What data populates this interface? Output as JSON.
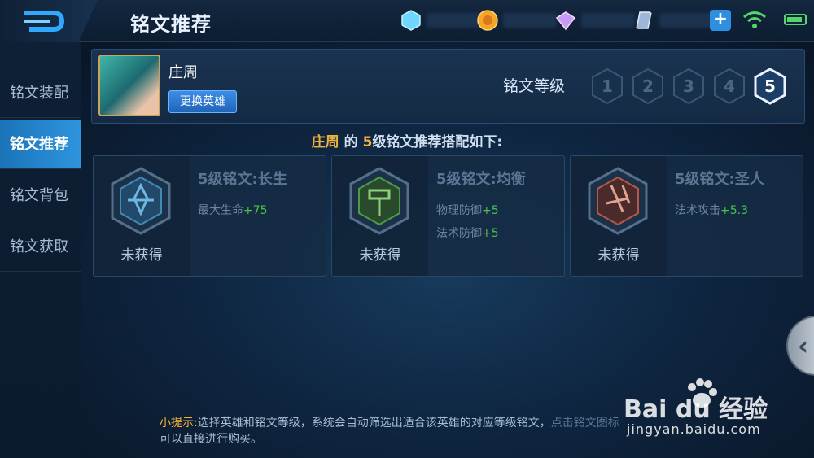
{
  "window": {
    "title": "铭文推荐"
  },
  "topbar": {
    "back_icon": "back-arrow-icon",
    "resources": [
      {
        "icon": "diamond-crystal-icon",
        "color": "#6fd6ff"
      },
      {
        "icon": "gold-coin-icon",
        "color": "#f5a623"
      },
      {
        "icon": "purple-gem-icon",
        "color": "#c79bf5"
      },
      {
        "icon": "silver-crystal-icon",
        "color": "#9fb6d8"
      }
    ],
    "plus_label": "+",
    "wifi_icon": "wifi-icon",
    "battery_icon": "battery-icon"
  },
  "sidebar": {
    "items": [
      {
        "label": "铭文装配",
        "active": false
      },
      {
        "label": "铭文推荐",
        "active": true
      },
      {
        "label": "铭文背包",
        "active": false
      },
      {
        "label": "铭文获取",
        "active": false
      }
    ]
  },
  "hero": {
    "name": "庄周",
    "change_button": "更换英雄",
    "level_label": "铭文等级",
    "levels": [
      "1",
      "2",
      "3",
      "4",
      "5"
    ],
    "selected_level": "5"
  },
  "headline": {
    "hero": "庄周",
    "middle": "的",
    "level": "5",
    "rest": "级铭文推荐搭配如下:"
  },
  "cards": [
    {
      "title": "5级铭文:长生",
      "status": "未获得",
      "rune_color": "#3f8bb8",
      "stats": [
        {
          "name": "最大生命",
          "value": "+75"
        }
      ]
    },
    {
      "title": "5级铭文:均衡",
      "status": "未获得",
      "rune_color": "#4f9a4a",
      "stats": [
        {
          "name": "物理防御",
          "value": "+5"
        },
        {
          "name": "法术防御",
          "value": "+5"
        }
      ]
    },
    {
      "title": "5级铭文:圣人",
      "status": "未获得",
      "rune_color": "#b8564a",
      "stats": [
        {
          "name": "法术攻击",
          "value": "+5.3"
        }
      ]
    }
  ],
  "tip": {
    "label": "小提示:",
    "text": "选择英雄和铭文等级，系统会自动筛选出适合该英雄的对应等级铭文，",
    "cut": "点击铭文图标",
    "line2": "可以直接进行购买。"
  },
  "watermark": {
    "logo": "Bai du 经验",
    "url": "jingyan.baidu.com"
  }
}
